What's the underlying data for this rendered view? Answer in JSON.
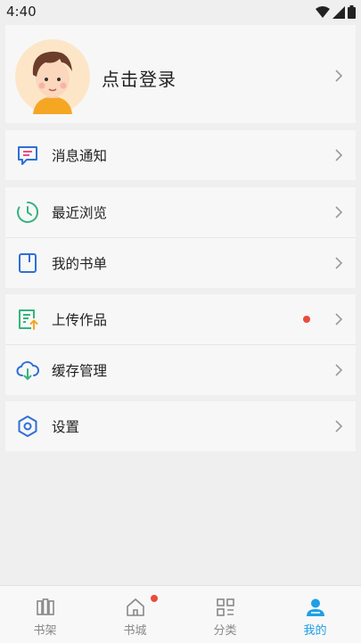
{
  "status_bar": {
    "time": "4:40"
  },
  "profile": {
    "login_label": "点击登录"
  },
  "menu": {
    "notifications": "消息通知",
    "recent": "最近浏览",
    "my_booklist": "我的书单",
    "upload_works": "上传作品",
    "cache_manage": "缓存管理",
    "settings": "设置"
  },
  "tabs": [
    {
      "label": "书架",
      "icon": "bookshelf-icon"
    },
    {
      "label": "书城",
      "icon": "home-icon",
      "badge": true
    },
    {
      "label": "分类",
      "icon": "grid-icon"
    },
    {
      "label": "我的",
      "icon": "person-icon",
      "active": true
    }
  ],
  "colors": {
    "accent": "#1ea0e6",
    "badge": "#e94c3d",
    "icon_blue": "#2f6fd6",
    "icon_green": "#36b37e",
    "icon_pink": "#e84d8a"
  }
}
